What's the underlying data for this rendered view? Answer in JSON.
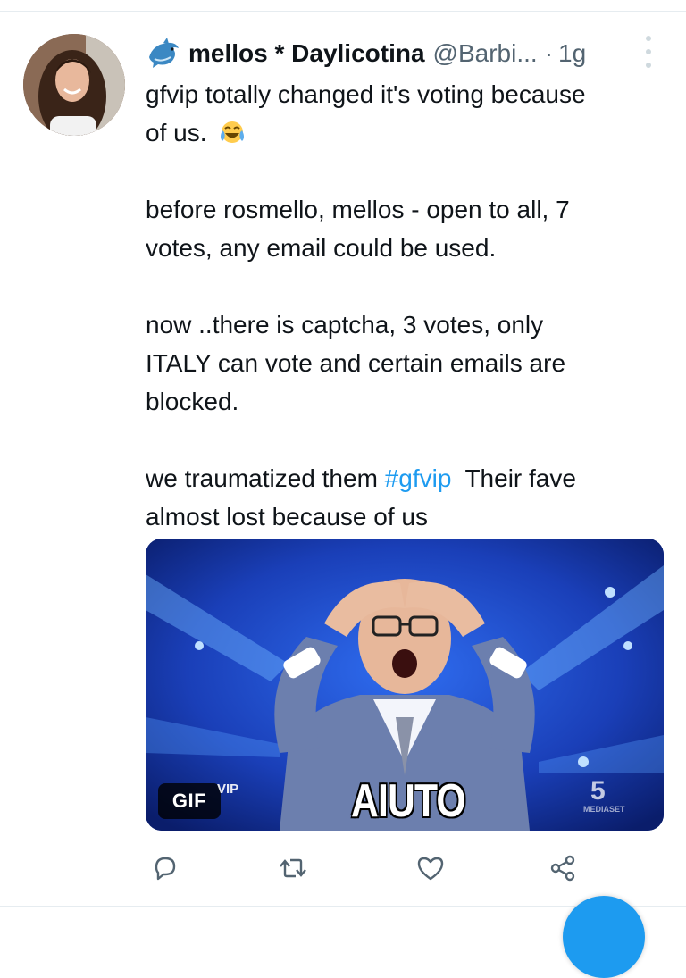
{
  "tweet": {
    "display_name": "mellos * Daylicotina",
    "handle": "@Barbi...",
    "separator": "·",
    "time": "1g",
    "text": {
      "line1": "gfvip totally changed it's voting because",
      "line2": "of us.",
      "p2_line1": "before rosmello, mellos - open to all, 7",
      "p2_line2": "votes, any email could be used.",
      "p3_line1": "now ..there is captcha, 3 votes, only",
      "p3_line2": "ITALY can vote and certain emails are",
      "p3_line3": "blocked.",
      "p4_pre": "we traumatized them ",
      "p4_hashtag": "#gfvip",
      "p4_post": "  Their fave",
      "p4_line2": "almost lost because of us"
    },
    "emoji": "face-with-tears-of-joy",
    "media": {
      "badge": "GIF",
      "caption": "AIUTO",
      "watermark_vip": "VIP",
      "channel_logo": "5",
      "channel_sub": "MEDIASET"
    }
  },
  "icons": {
    "name_prefix": "dolphin-icon",
    "more": "more-vertical-icon",
    "reply": "reply-icon",
    "retweet": "retweet-icon",
    "like": "heart-icon",
    "share": "share-icon"
  },
  "colors": {
    "accent": "#1d9bf0",
    "text": "#0f1419",
    "secondary": "#536471"
  }
}
